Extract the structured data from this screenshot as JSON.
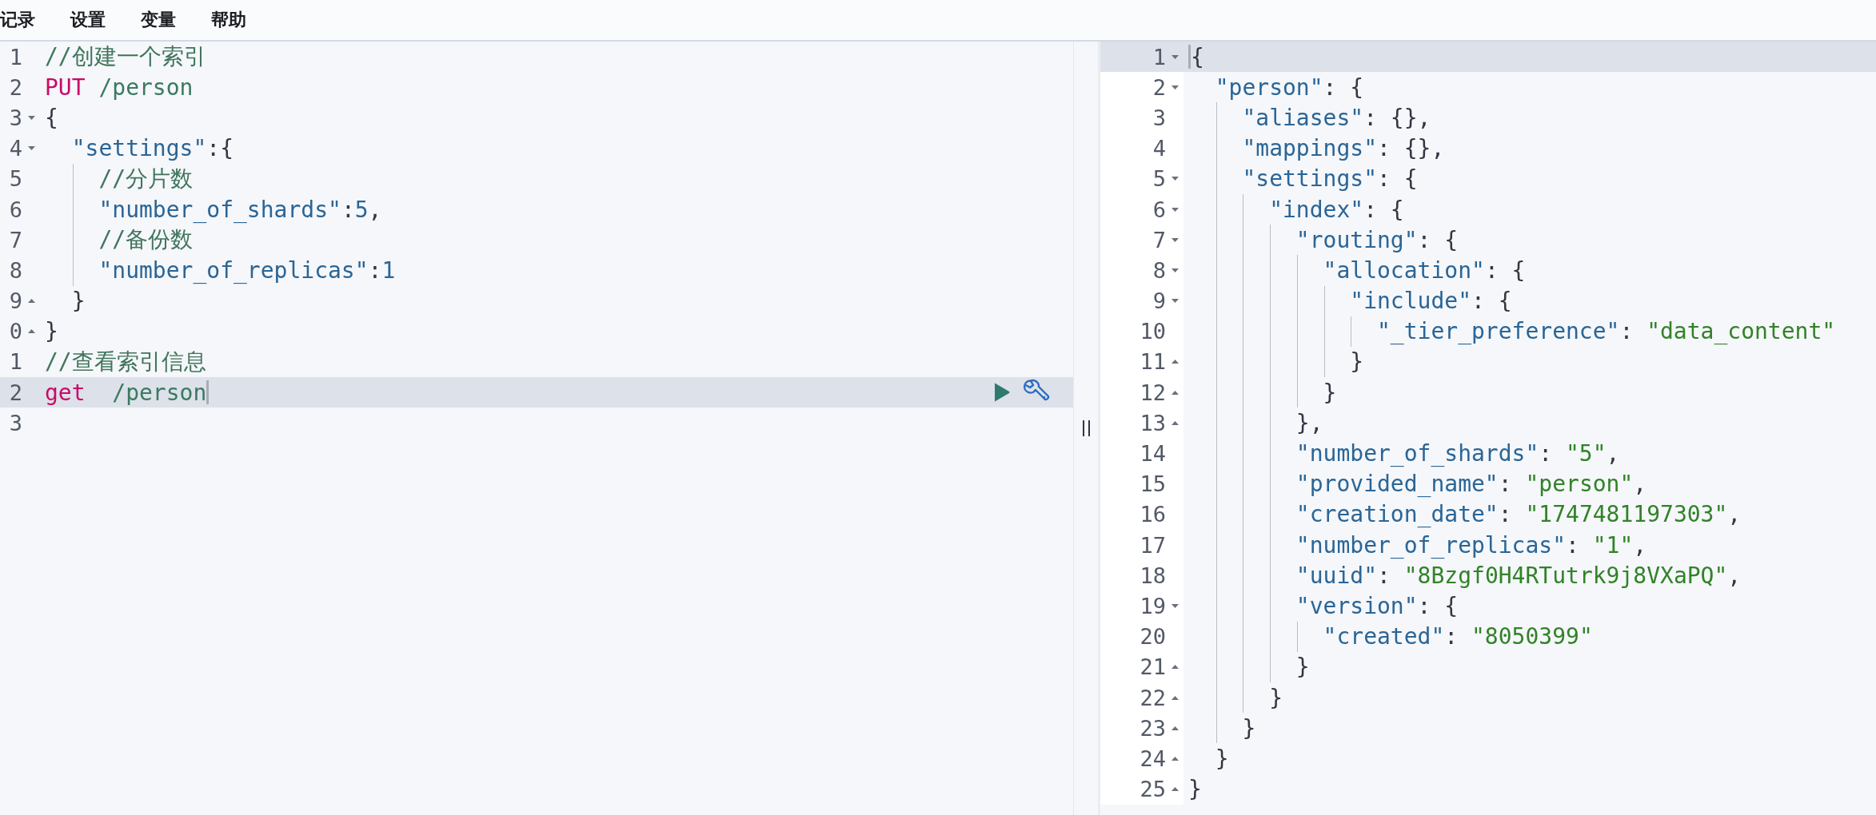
{
  "menu": [
    {
      "label": "记录"
    },
    {
      "label": "设置"
    },
    {
      "label": "变量"
    },
    {
      "label": "帮助"
    }
  ],
  "request_editor": {
    "lines": [
      {
        "number": "1",
        "fold_start": false,
        "fold_end": false,
        "active": false,
        "tokens": [
          {
            "kind": "comment",
            "text": "//创建一个索引"
          }
        ]
      },
      {
        "number": "2",
        "fold_start": false,
        "fold_end": false,
        "active": false,
        "tokens": [
          {
            "kind": "method",
            "text": "PUT"
          },
          {
            "kind": "path",
            "text": " /person"
          }
        ]
      },
      {
        "number": "3",
        "fold_start": true,
        "fold_end": false,
        "active": false,
        "tokens": [
          {
            "kind": "punct",
            "text": "{"
          }
        ]
      },
      {
        "number": "4",
        "fold_start": true,
        "fold_end": false,
        "active": false,
        "tokens": [
          {
            "kind": "key",
            "text": "  \"settings\""
          },
          {
            "kind": "punct",
            "text": ":{"
          }
        ]
      },
      {
        "number": "5",
        "fold_start": false,
        "fold_end": false,
        "active": false,
        "tokens": [
          {
            "kind": "comment",
            "text": "    //分片数"
          }
        ]
      },
      {
        "number": "6",
        "fold_start": false,
        "fold_end": false,
        "active": false,
        "tokens": [
          {
            "kind": "key",
            "text": "    \"number_of_shards\""
          },
          {
            "kind": "punct",
            "text": ":"
          },
          {
            "kind": "number",
            "text": "5"
          },
          {
            "kind": "punct",
            "text": ","
          }
        ]
      },
      {
        "number": "7",
        "fold_start": false,
        "fold_end": false,
        "active": false,
        "tokens": [
          {
            "kind": "comment",
            "text": "    //备份数"
          }
        ]
      },
      {
        "number": "8",
        "fold_start": false,
        "fold_end": false,
        "active": false,
        "tokens": [
          {
            "kind": "key",
            "text": "    \"number_of_replicas\""
          },
          {
            "kind": "punct",
            "text": ":"
          },
          {
            "kind": "number",
            "text": "1"
          }
        ]
      },
      {
        "number": "9",
        "fold_start": false,
        "fold_end": true,
        "active": false,
        "tokens": [
          {
            "kind": "punct",
            "text": "  }"
          }
        ]
      },
      {
        "number": "0",
        "fold_start": false,
        "fold_end": true,
        "active": false,
        "tokens": [
          {
            "kind": "punct",
            "text": "}"
          }
        ]
      },
      {
        "number": "1",
        "fold_start": false,
        "fold_end": false,
        "active": false,
        "tokens": [
          {
            "kind": "comment",
            "text": "//查看索引信息"
          }
        ]
      },
      {
        "number": "2",
        "fold_start": false,
        "fold_end": false,
        "active": true,
        "tokens": [
          {
            "kind": "method",
            "text": "get"
          },
          {
            "kind": "path",
            "text": "  /person"
          },
          {
            "kind": "cursor"
          }
        ]
      },
      {
        "number": "3",
        "fold_start": false,
        "fold_end": false,
        "active": false
      }
    ]
  },
  "response_viewer": {
    "lines": [
      {
        "number": "1",
        "fold_start": true,
        "fold_end": false,
        "active": true,
        "tokens": [
          {
            "kind": "cursor"
          },
          {
            "kind": "punct",
            "text": "{"
          }
        ]
      },
      {
        "number": "2",
        "fold_start": true,
        "fold_end": false,
        "active": false,
        "tokens": [
          {
            "kind": "key",
            "text": "  \"person\""
          },
          {
            "kind": "punct",
            "text": ": {"
          }
        ]
      },
      {
        "number": "3",
        "fold_start": false,
        "fold_end": false,
        "active": false,
        "tokens": [
          {
            "kind": "key",
            "text": "    \"aliases\""
          },
          {
            "kind": "punct",
            "text": ": {},"
          }
        ]
      },
      {
        "number": "4",
        "fold_start": false,
        "fold_end": false,
        "active": false,
        "tokens": [
          {
            "kind": "key",
            "text": "    \"mappings\""
          },
          {
            "kind": "punct",
            "text": ": {},"
          }
        ]
      },
      {
        "number": "5",
        "fold_start": true,
        "fold_end": false,
        "active": false,
        "tokens": [
          {
            "kind": "key",
            "text": "    \"settings\""
          },
          {
            "kind": "punct",
            "text": ": {"
          }
        ]
      },
      {
        "number": "6",
        "fold_start": true,
        "fold_end": false,
        "active": false,
        "tokens": [
          {
            "kind": "key",
            "text": "      \"index\""
          },
          {
            "kind": "punct",
            "text": ": {"
          }
        ]
      },
      {
        "number": "7",
        "fold_start": true,
        "fold_end": false,
        "active": false,
        "tokens": [
          {
            "kind": "key",
            "text": "        \"routing\""
          },
          {
            "kind": "punct",
            "text": ": {"
          }
        ]
      },
      {
        "number": "8",
        "fold_start": true,
        "fold_end": false,
        "active": false,
        "tokens": [
          {
            "kind": "key",
            "text": "          \"allocation\""
          },
          {
            "kind": "punct",
            "text": ": {"
          }
        ]
      },
      {
        "number": "9",
        "fold_start": true,
        "fold_end": false,
        "active": false,
        "tokens": [
          {
            "kind": "key",
            "text": "            \"include\""
          },
          {
            "kind": "punct",
            "text": ": {"
          }
        ]
      },
      {
        "number": "10",
        "fold_start": false,
        "fold_end": false,
        "active": false,
        "tokens": [
          {
            "kind": "key",
            "text": "              \"_tier_preference\""
          },
          {
            "kind": "punct",
            "text": ": "
          },
          {
            "kind": "string",
            "text": "\"data_content\""
          }
        ]
      },
      {
        "number": "11",
        "fold_start": false,
        "fold_end": true,
        "active": false,
        "tokens": [
          {
            "kind": "punct",
            "text": "            }"
          }
        ]
      },
      {
        "number": "12",
        "fold_start": false,
        "fold_end": true,
        "active": false,
        "tokens": [
          {
            "kind": "punct",
            "text": "          }"
          }
        ]
      },
      {
        "number": "13",
        "fold_start": false,
        "fold_end": true,
        "active": false,
        "tokens": [
          {
            "kind": "punct",
            "text": "        },"
          }
        ]
      },
      {
        "number": "14",
        "fold_start": false,
        "fold_end": false,
        "active": false,
        "tokens": [
          {
            "kind": "key",
            "text": "        \"number_of_shards\""
          },
          {
            "kind": "punct",
            "text": ": "
          },
          {
            "kind": "string",
            "text": "\"5\""
          },
          {
            "kind": "punct",
            "text": ","
          }
        ]
      },
      {
        "number": "15",
        "fold_start": false,
        "fold_end": false,
        "active": false,
        "tokens": [
          {
            "kind": "key",
            "text": "        \"provided_name\""
          },
          {
            "kind": "punct",
            "text": ": "
          },
          {
            "kind": "string",
            "text": "\"person\""
          },
          {
            "kind": "punct",
            "text": ","
          }
        ]
      },
      {
        "number": "16",
        "fold_start": false,
        "fold_end": false,
        "active": false,
        "tokens": [
          {
            "kind": "key",
            "text": "        \"creation_date\""
          },
          {
            "kind": "punct",
            "text": ": "
          },
          {
            "kind": "string",
            "text": "\"1747481197303\""
          },
          {
            "kind": "punct",
            "text": ","
          }
        ]
      },
      {
        "number": "17",
        "fold_start": false,
        "fold_end": false,
        "active": false,
        "tokens": [
          {
            "kind": "key",
            "text": "        \"number_of_replicas\""
          },
          {
            "kind": "punct",
            "text": ": "
          },
          {
            "kind": "string",
            "text": "\"1\""
          },
          {
            "kind": "punct",
            "text": ","
          }
        ]
      },
      {
        "number": "18",
        "fold_start": false,
        "fold_end": false,
        "active": false,
        "tokens": [
          {
            "kind": "key",
            "text": "        \"uuid\""
          },
          {
            "kind": "punct",
            "text": ": "
          },
          {
            "kind": "string",
            "text": "\"8Bzgf0H4RTutrk9j8VXaPQ\""
          },
          {
            "kind": "punct",
            "text": ","
          }
        ]
      },
      {
        "number": "19",
        "fold_start": true,
        "fold_end": false,
        "active": false,
        "tokens": [
          {
            "kind": "key",
            "text": "        \"version\""
          },
          {
            "kind": "punct",
            "text": ": {"
          }
        ]
      },
      {
        "number": "20",
        "fold_start": false,
        "fold_end": false,
        "active": false,
        "tokens": [
          {
            "kind": "key",
            "text": "          \"created\""
          },
          {
            "kind": "punct",
            "text": ": "
          },
          {
            "kind": "string",
            "text": "\"8050399\""
          }
        ]
      },
      {
        "number": "21",
        "fold_start": false,
        "fold_end": true,
        "active": false,
        "tokens": [
          {
            "kind": "punct",
            "text": "        }"
          }
        ]
      },
      {
        "number": "22",
        "fold_start": false,
        "fold_end": true,
        "active": false,
        "tokens": [
          {
            "kind": "punct",
            "text": "      }"
          }
        ]
      },
      {
        "number": "23",
        "fold_start": false,
        "fold_end": true,
        "active": false,
        "tokens": [
          {
            "kind": "punct",
            "text": "    }"
          }
        ]
      },
      {
        "number": "24",
        "fold_start": false,
        "fold_end": true,
        "active": false,
        "tokens": [
          {
            "kind": "punct",
            "text": "  }"
          }
        ]
      },
      {
        "number": "25",
        "fold_start": false,
        "fold_end": true,
        "active": false,
        "tokens": [
          {
            "kind": "punct",
            "text": "}"
          }
        ]
      }
    ]
  }
}
